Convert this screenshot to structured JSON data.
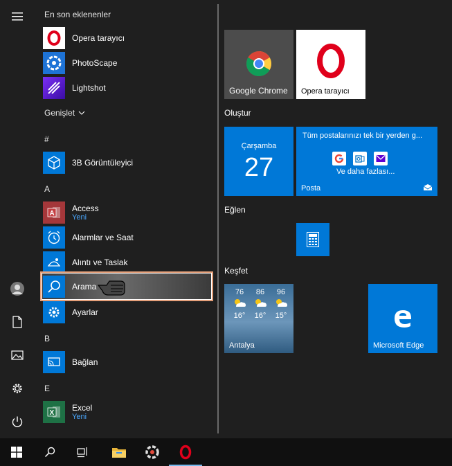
{
  "recently_added": {
    "title": "En son eklenenler",
    "items": [
      {
        "name": "Opera tarayıcı",
        "icon": "opera-icon"
      },
      {
        "name": "PhotoScape",
        "icon": "photoscape-icon"
      },
      {
        "name": "Lightshot",
        "icon": "lightshot-icon"
      }
    ],
    "expand_label": "Genişlet"
  },
  "app_list": {
    "letters": [
      "#",
      "A",
      "B",
      "E"
    ],
    "items": [
      {
        "name": "3B Görüntüleyici",
        "sub": ""
      },
      {
        "name": "Access",
        "sub": "Yeni"
      },
      {
        "name": "Alarmlar ve Saat",
        "sub": ""
      },
      {
        "name": "Alıntı ve Taslak",
        "sub": ""
      },
      {
        "name": "Arama",
        "sub": ""
      },
      {
        "name": "Ayarlar",
        "sub": ""
      },
      {
        "name": "Bağlan",
        "sub": ""
      },
      {
        "name": "Excel",
        "sub": "Yeni"
      }
    ]
  },
  "tiles": {
    "top": [
      {
        "label": "Google Chrome"
      },
      {
        "label": "Opera tarayıcı"
      }
    ],
    "groups": {
      "olustur": "Oluştur",
      "eglen": "Eğlen",
      "kesfet": "Keşfet"
    },
    "calendar": {
      "day": "Çarşamba",
      "date": "27"
    },
    "mail": {
      "text": "Tüm postalarınızı tek bir yerden g...",
      "more": "Ve daha fazlası...",
      "label": "Posta"
    },
    "weather": {
      "location": "Antalya",
      "highs": [
        "76",
        "86",
        "96"
      ],
      "lows": [
        "16°",
        "16°",
        "15°"
      ]
    },
    "edge": {
      "label": "Microsoft Edge"
    }
  },
  "colors": {
    "accent": "#0078d7",
    "tile_gray": "#4c4c4c",
    "background": "#1f1f1f",
    "taskbar": "#101010"
  }
}
